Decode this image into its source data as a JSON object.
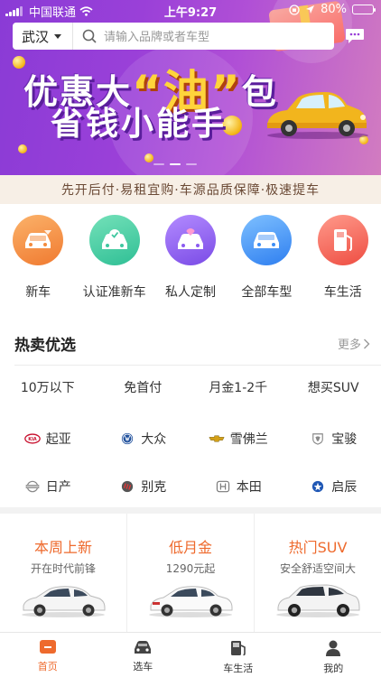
{
  "status_bar": {
    "carrier": "中国联通",
    "time": "上午9:27",
    "battery": "80%",
    "battery_level": 0.8
  },
  "header": {
    "city": "武汉",
    "search_placeholder": "请输入品牌或者车型",
    "message_icon": "chat-bubble-icon"
  },
  "banner": {
    "line1_a": "优惠大",
    "line1_highlight": "“油”",
    "line1_b": "包",
    "line2": "省钱小能手",
    "slide_count": 3,
    "active_slide": 2
  },
  "slogan": "先开后付·易租宜购·车源品质保障·极速提车",
  "categories": [
    {
      "label": "新车",
      "icon": "new-car-icon",
      "color": "#f48a3c"
    },
    {
      "label": "认证准新车",
      "icon": "certified-car-icon",
      "color": "#40c7a0"
    },
    {
      "label": "私人定制",
      "icon": "custom-car-icon",
      "color": "#8b5cf0"
    },
    {
      "label": "全部车型",
      "icon": "all-models-icon",
      "color": "#3d8ef5"
    },
    {
      "label": "车生活",
      "icon": "fuel-pump-icon",
      "color": "#f25c4f"
    }
  ],
  "hot": {
    "title": "热卖优选",
    "more": "更多",
    "filters": [
      "10万以下",
      "免首付",
      "月金1-2千",
      "想买SUV"
    ],
    "brands_row1": [
      {
        "label": "起亚",
        "logo": "kia-logo-icon"
      },
      {
        "label": "大众",
        "logo": "vw-logo-icon"
      },
      {
        "label": "雪佛兰",
        "logo": "chevrolet-logo-icon"
      },
      {
        "label": "宝骏",
        "logo": "baojun-logo-icon"
      }
    ],
    "brands_row2": [
      {
        "label": "日产",
        "logo": "nissan-logo-icon"
      },
      {
        "label": "别克",
        "logo": "buick-logo-icon"
      },
      {
        "label": "本田",
        "logo": "honda-logo-icon"
      },
      {
        "label": "启辰",
        "logo": "venucia-logo-icon"
      }
    ]
  },
  "promos": [
    {
      "title": "本周上新",
      "sub": "开在时代前锋"
    },
    {
      "title": "低月金",
      "sub": "1290元起"
    },
    {
      "title": "热门SUV",
      "sub": "安全舒适空间大"
    }
  ],
  "tabs": [
    {
      "label": "首页",
      "icon": "home-icon",
      "active": true
    },
    {
      "label": "选车",
      "icon": "car-icon",
      "active": false
    },
    {
      "label": "车生活",
      "icon": "fuel-pump-icon",
      "active": false
    },
    {
      "label": "我的",
      "icon": "user-icon",
      "active": false
    }
  ],
  "colors": {
    "accent": "#ee6a2d",
    "banner_purple": "#9a40d8",
    "slogan_bg": "#f7efe6"
  }
}
